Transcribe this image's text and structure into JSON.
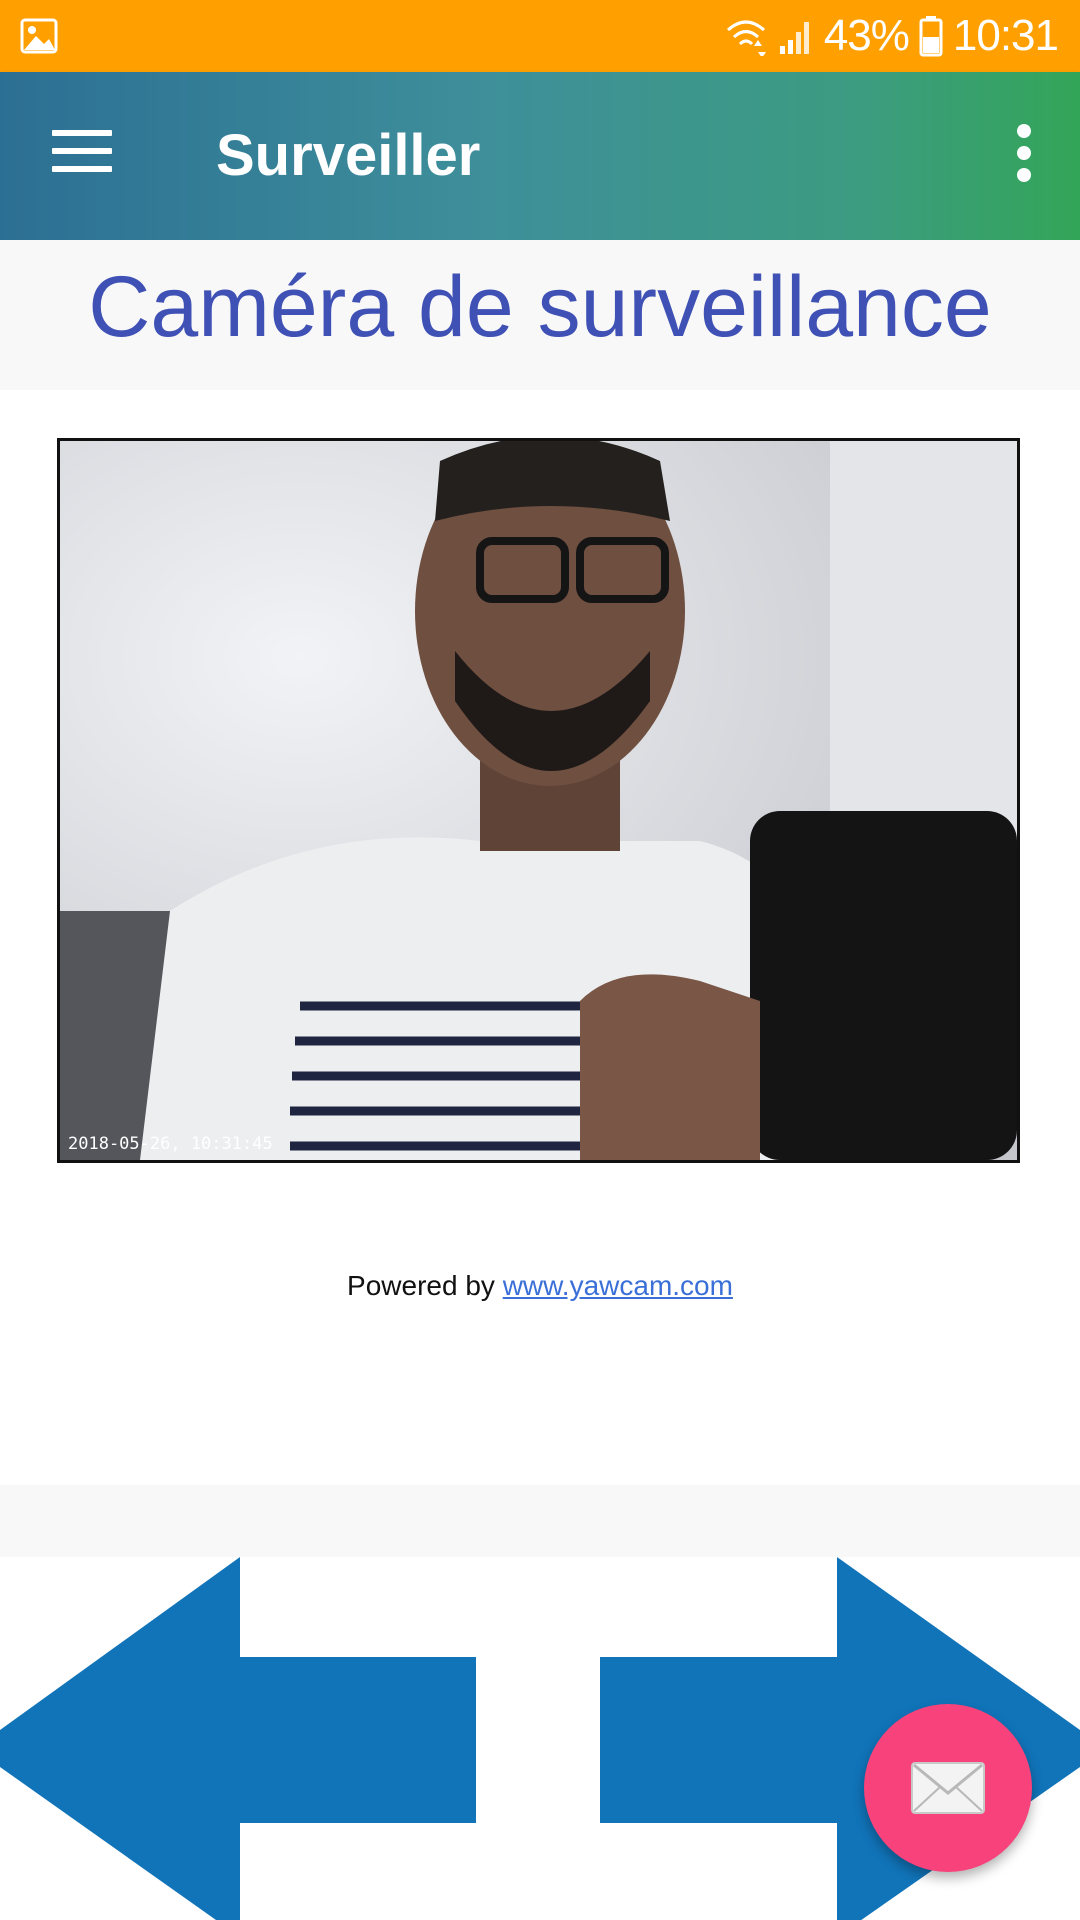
{
  "status_bar": {
    "battery": "43%",
    "time": "10:31",
    "icons": [
      "gallery-icon",
      "wifi-icon",
      "signal-icon",
      "battery-icon"
    ]
  },
  "app_bar": {
    "title": "Surveiller",
    "icons": [
      "menu-icon",
      "more-vert-icon"
    ]
  },
  "page": {
    "heading": "Caméra de surveillance",
    "camera_timestamp": "2018-05-26, 10:31:45",
    "powered_by": "Powered by ",
    "link_text": "www.yawcam.com"
  },
  "navigation": {
    "previous_icon": "arrow-left-icon",
    "next_icon": "arrow-right-icon"
  },
  "fab": {
    "icon": "mail-icon"
  },
  "colors": {
    "status_bar": "#FFA000",
    "app_bar_start": "#2C6F94",
    "app_bar_end": "#33A558",
    "heading": "#3F51B5",
    "arrow": "#1174B9",
    "fab": "#F7427B"
  }
}
